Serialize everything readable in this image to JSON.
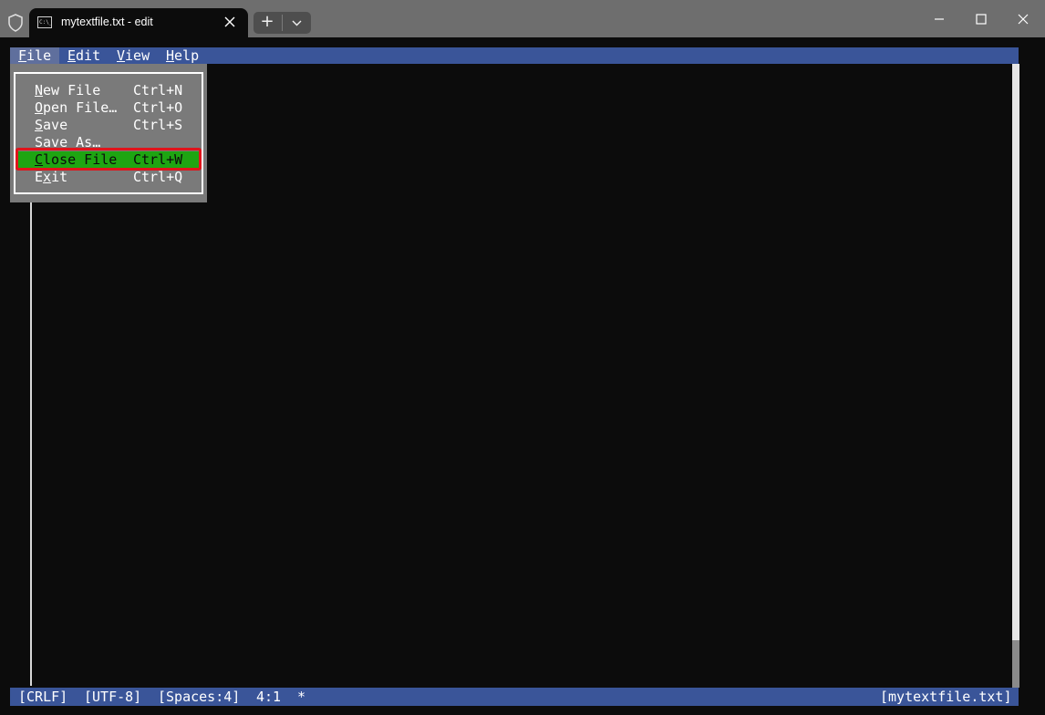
{
  "window": {
    "tab_title": "mytextfile.txt - edit",
    "tab_icon_text": "C:\\_",
    "new_tab_glyph": "+"
  },
  "menubar": {
    "items": [
      {
        "label": "File",
        "accel": "F",
        "rest": "ile"
      },
      {
        "label": "Edit",
        "accel": "E",
        "rest": "dit"
      },
      {
        "label": "View",
        "accel": "V",
        "rest": "iew"
      },
      {
        "label": "Help",
        "accel": "H",
        "rest": "elp"
      }
    ]
  },
  "file_menu": {
    "items": [
      {
        "label": "New File",
        "accel": "N",
        "rest": "ew File",
        "shortcut": "Ctrl+N"
      },
      {
        "label": "Open File…",
        "accel": "O",
        "rest": "pen File…",
        "shortcut": "Ctrl+O"
      },
      {
        "label": "Save",
        "accel": "S",
        "rest": "ave",
        "shortcut": "Ctrl+S"
      },
      {
        "label": "Save As…",
        "accel": "",
        "rest": "Save As…",
        "shortcut": ""
      },
      {
        "label": "Close File",
        "accel": "C",
        "rest": "lose File",
        "shortcut": "Ctrl+W",
        "selected": true
      },
      {
        "label": "Exit",
        "accel_pre": "E",
        "accel": "x",
        "rest": "it",
        "shortcut": "Ctrl+Q"
      }
    ]
  },
  "statusbar": {
    "line_ending": "[CRLF]",
    "encoding": "[UTF-8]",
    "indent": "[Spaces:4]",
    "position": "4:1",
    "modified": "*",
    "filename": "[mytextfile.txt]"
  },
  "colors": {
    "menubar_bg": "#3a5599",
    "selected_item_bg": "#1ea512",
    "highlight_outline": "#e0141c",
    "editor_bg": "#0c0c0c"
  }
}
